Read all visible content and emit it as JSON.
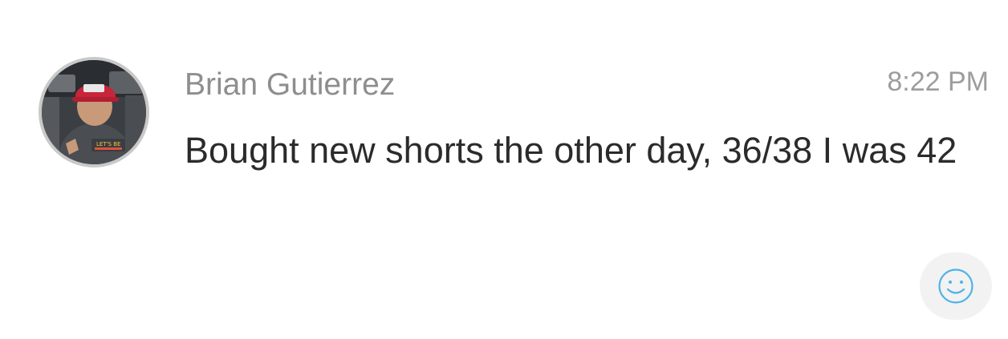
{
  "message": {
    "sender": "Brian Gutierrez",
    "time": "8:22 PM",
    "text": "Bought new shorts the other day, 36/38 I was 42",
    "avatar": {
      "description_icon": "user-avatar",
      "shirt_text": "LET'S BE"
    },
    "reaction_icon": "smiley-face-icon"
  },
  "colors": {
    "sender": "#8e8e8e",
    "time": "#9d9d9d",
    "text": "#2b2b2b",
    "reaction_accent": "#4fb3e8",
    "reaction_bg": "#f2f2f2"
  }
}
